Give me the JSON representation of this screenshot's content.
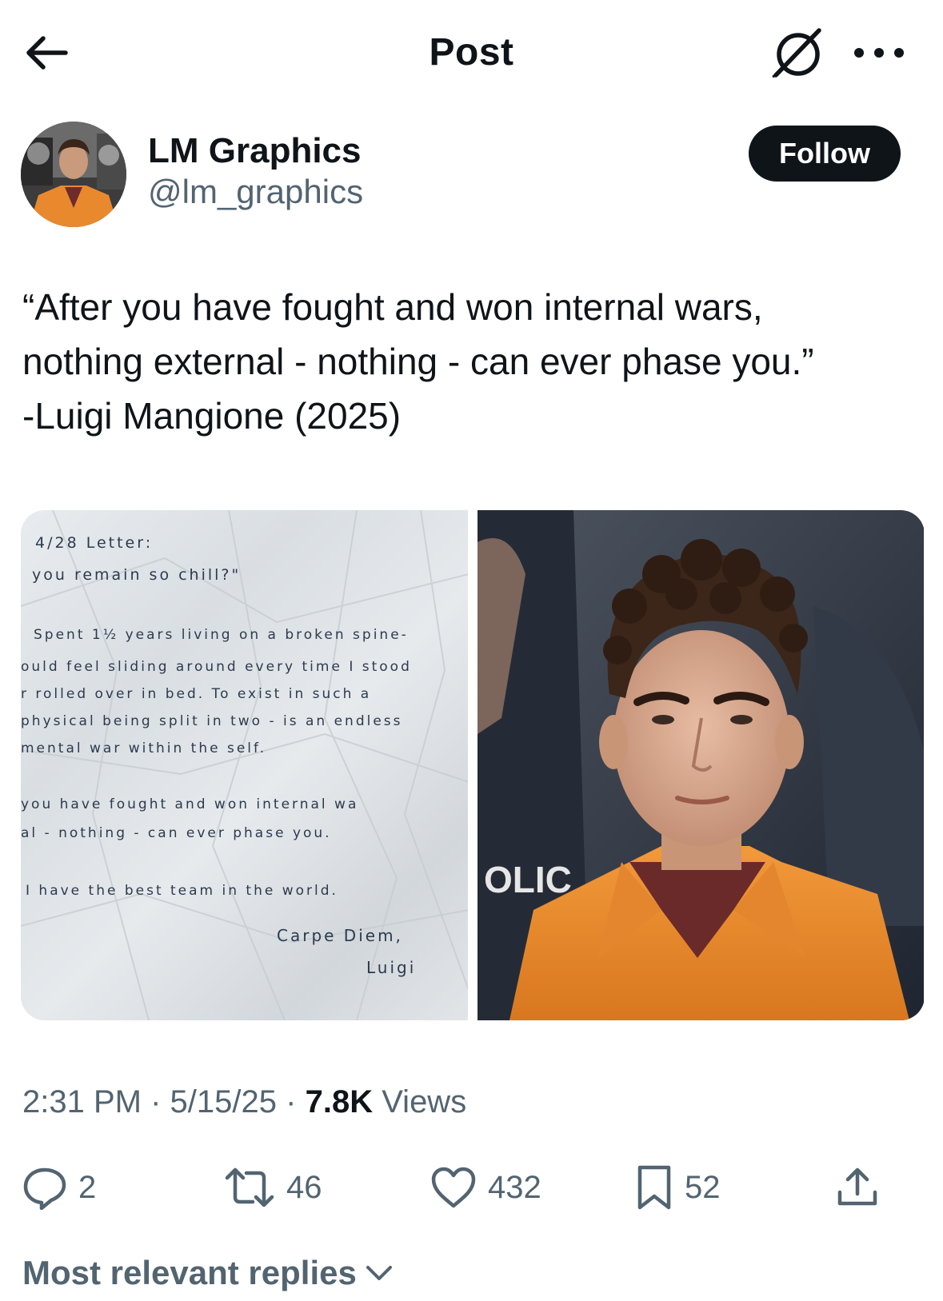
{
  "header": {
    "title": "Post",
    "back_icon": "arrow-left-icon",
    "grok_icon": "grok-icon",
    "more_icon": "more-horizontal-icon"
  },
  "author": {
    "name": "LM Graphics",
    "handle": "@lm_graphics",
    "follow_label": "Follow"
  },
  "tweet": {
    "lines": [
      "“After you have fought and won internal wars,",
      "nothing external - nothing - can ever phase you.”",
      "-Luigi Mangione (2025)"
    ]
  },
  "media": {
    "letter_lines": [
      "4/28 Letter:",
      "you remain so chill?\"",
      "Spent 1½ years living on a broken spine-",
      "ould feel sliding around every time I stood",
      "r rolled over in bed. To exist in such a",
      "physical being split in two - is an endless",
      "mental war within the self.",
      "you have fought and won internal wa",
      "al - nothing - can ever phase you.",
      "I have the best team in the world.",
      "Carpe Diem,",
      "Luigi"
    ],
    "photo_sign_text": "OLIC"
  },
  "meta": {
    "time": "2:31 PM",
    "date": "5/15/25",
    "views_count": "7.8K",
    "views_label": "Views",
    "separator": "·"
  },
  "actions": {
    "replies": "2",
    "reposts": "46",
    "likes": "432",
    "bookmarks": "52"
  },
  "replies_sort": {
    "label": "Most relevant replies"
  },
  "colors": {
    "text_primary": "#0f1419",
    "text_secondary": "#536471",
    "jumpsuit_orange": "#e8892e"
  }
}
